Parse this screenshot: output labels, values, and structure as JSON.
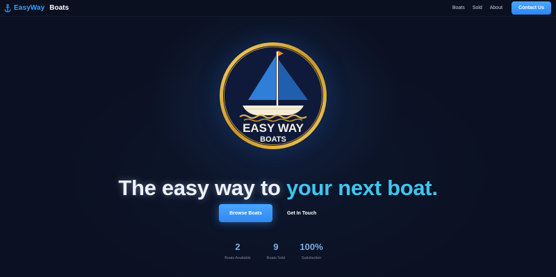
{
  "header": {
    "brand_primary": "EasyWay",
    "brand_secondary": "Boats",
    "nav_links": [
      "Boats",
      "Sold",
      "About"
    ],
    "contact_button": "Contact Us"
  },
  "logo": {
    "line1": "EASY WAY",
    "line2": "BOATS"
  },
  "hero": {
    "headline_main": "The easy way to ",
    "headline_accent": "your next boat.",
    "primary_button": "Browse Boats",
    "secondary_button": "Get In Touch"
  },
  "stats": [
    {
      "value": "2",
      "label": "Boats Available"
    },
    {
      "value": "9",
      "label": "Boats Sold"
    },
    {
      "value": "100%",
      "label": "Satisfaction"
    }
  ],
  "colors": {
    "background": "#0b1122",
    "accent_blue": "#3aa0ff",
    "headline_accent": "#3ec6f0",
    "gold_ring": "#e2b84a",
    "stat_value": "#7aaee8"
  },
  "icons": {
    "brand": "anchor-icon"
  }
}
